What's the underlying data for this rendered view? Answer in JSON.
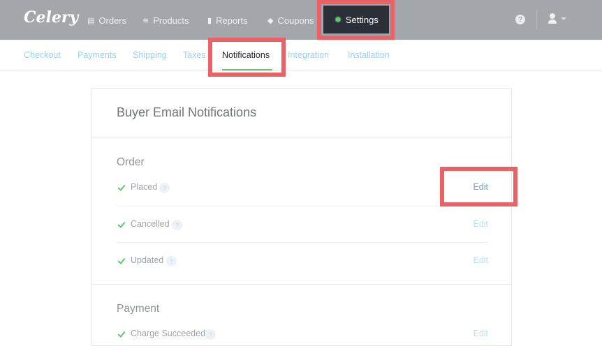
{
  "app": {
    "logo": "Celery"
  },
  "topnav": {
    "items": [
      {
        "label": "Orders",
        "icon": "orders-icon"
      },
      {
        "label": "Products",
        "icon": "products-icon"
      },
      {
        "label": "Reports",
        "icon": "reports-icon"
      },
      {
        "label": "Coupons",
        "icon": "coupons-icon"
      }
    ],
    "active": {
      "label": "Settings",
      "icon": "gear-icon"
    },
    "help_icon": "help-icon",
    "help_glyph": "?",
    "user_icon": "user-icon"
  },
  "subnav": {
    "tabs": [
      {
        "label": "Checkout"
      },
      {
        "label": "Payments"
      },
      {
        "label": "Shipping"
      },
      {
        "label": "Taxes"
      },
      {
        "label": "Notifications",
        "active": true
      },
      {
        "label": "Integration"
      },
      {
        "label": "Installation"
      }
    ]
  },
  "card": {
    "title": "Buyer Email Notifications",
    "sections": [
      {
        "title": "Order",
        "rows": [
          {
            "label": "Placed",
            "checked": true,
            "help": "?",
            "edit": "Edit"
          },
          {
            "label": "Cancelled",
            "checked": true,
            "help": "?",
            "edit": "Edit"
          },
          {
            "label": "Updated",
            "checked": true,
            "help": "?",
            "edit": "Edit"
          }
        ]
      },
      {
        "title": "Payment",
        "rows": [
          {
            "label": "Charge Succeeded",
            "checked": true,
            "help": "?",
            "edit": "Edit"
          }
        ]
      }
    ]
  },
  "colors": {
    "topbar": "#a3a6ab",
    "active_nav": "#2b2f38",
    "accent_green": "#5cc86a",
    "link_blue": "#5aa9de",
    "highlight": "#ea6265"
  }
}
